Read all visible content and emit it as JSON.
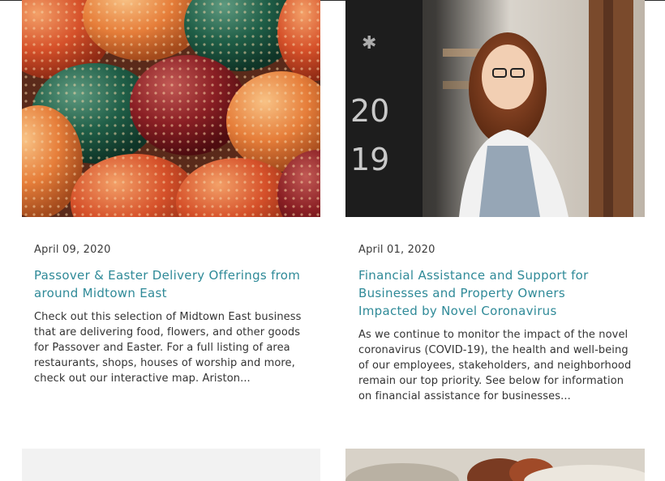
{
  "posts": [
    {
      "date": "April 09, 2020",
      "title": "Passover & Easter Delivery Offerings from around Midtown East",
      "excerpt": "Check out this selection of Midtown East business that are delivering food, flowers, and other goods for Passover and Easter. For a full listing of area restaurants, shops, houses of worship and more, check out our interactive map. Ariston...",
      "image": "painted-easter-eggs-photo"
    },
    {
      "date": "April 01, 2020",
      "title": "Financial Assistance and Support for Businesses and Property Owners Impacted by Novel Coronavirus",
      "excerpt": "As we continue to monitor the impact of the novel coronavirus (COVID-19), the health and well-being of our employees, stakeholders, and neighborhood remain our top priority. See below for information on financial assistance for businesses...",
      "image": "shop-owner-woman-photo"
    },
    {
      "image": "blank-placeholder-image"
    },
    {
      "image": "food-photo"
    }
  ],
  "colors": {
    "title_link": "#2f8a98",
    "body_text": "#333333",
    "date_text": "#3a3a3a"
  }
}
